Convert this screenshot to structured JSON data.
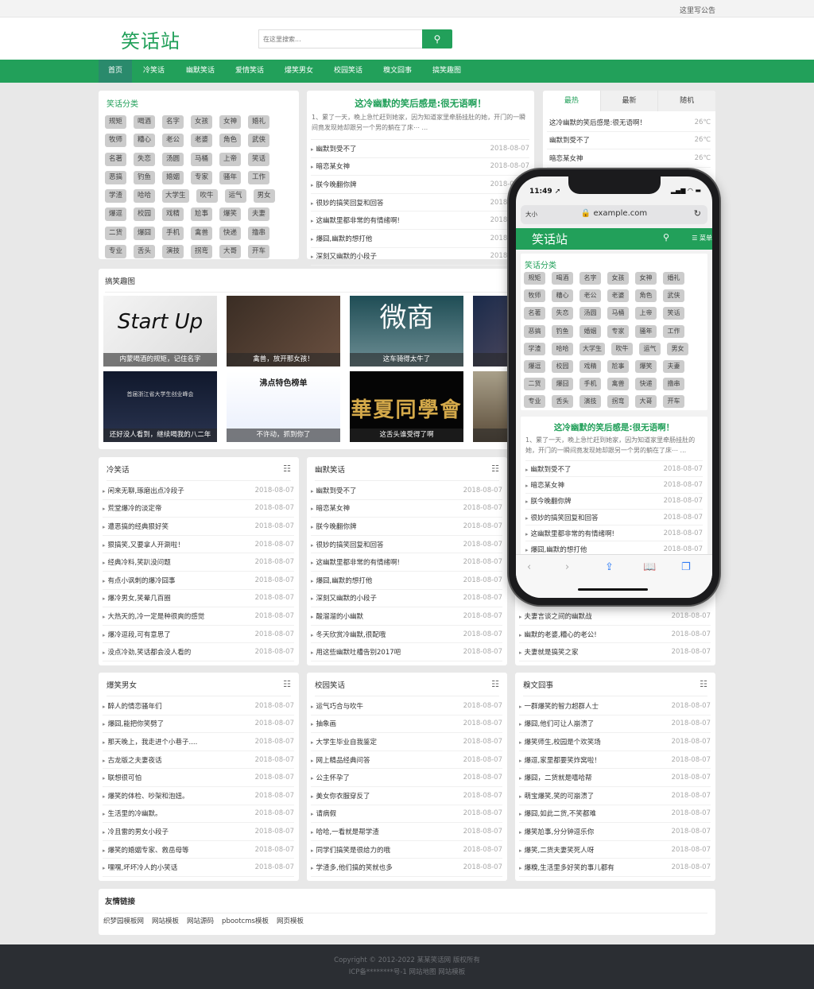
{
  "topbar": {
    "notice": "这里写公告"
  },
  "header": {
    "logo": "笑话站",
    "search_placeholder": "在这里搜索...",
    "search_icon": "search-icon"
  },
  "nav": [
    "首页",
    "冷笑话",
    "幽默笑话",
    "爱情笑话",
    "爆笑男女",
    "校园笑话",
    "糗文囧事",
    "搞笑趣图"
  ],
  "categories": {
    "title": "笑话分类",
    "rows": [
      [
        "规矩",
        "喝酒",
        "名字",
        "女孩",
        "女神",
        "婚礼"
      ],
      [
        "牧师",
        "糟心",
        "老公",
        "老婆",
        "角色",
        "武侠"
      ],
      [
        "名著",
        "失恋",
        "汤圆",
        "马桶",
        "上帝",
        "笑话"
      ],
      [
        "恶搞",
        "钓鱼",
        "婚姻",
        "专家",
        "骚年",
        "工作"
      ],
      [
        "学渣",
        "哈哈",
        "大学生",
        "吹牛",
        "运气",
        "男女"
      ],
      [
        "爆逗",
        "校园",
        "戏精",
        "尬事",
        "爆笑",
        "夫妻"
      ],
      [
        "二货",
        "爆囧",
        "手机",
        "禽兽",
        "快递",
        "撸串"
      ],
      [
        "专业",
        "舌头",
        "演技",
        "拐弯",
        "大哥",
        "开车"
      ]
    ]
  },
  "featured": {
    "title": "这冷幽默的笑后感是:很无语啊！",
    "summary": "1、累了一天，晚上急忙赶到她家，因为知道家里牵肠挂肚的她，开门的一瞬间竟发现她却跟另一个男的躺在了床⋯ ...",
    "items": [
      {
        "t": "幽默到受不了",
        "d": "2018-08-07"
      },
      {
        "t": "暗恋某女神",
        "d": "2018-08-07"
      },
      {
        "t": "朕今晚翻你牌",
        "d": "2018-08-07"
      },
      {
        "t": "很妙的搞笑回复和回答",
        "d": "2018-08-07"
      },
      {
        "t": "这幽默里都非常的有情绪啊!",
        "d": "2018-08-07"
      },
      {
        "t": "爆囧,幽默的想打他",
        "d": "2018-08-07"
      },
      {
        "t": "深刻又幽默的小段子",
        "d": "2018-08-07"
      }
    ]
  },
  "hot": {
    "tabs": [
      "最热",
      "最新",
      "随机"
    ],
    "items": [
      {
        "t": "这冷幽默的笑后感是:很无语啊！",
        "d": "26℃"
      },
      {
        "t": "幽默到受不了",
        "d": "26℃"
      },
      {
        "t": "暗恋某女神",
        "d": "26℃"
      }
    ]
  },
  "pictures": {
    "title": "搞笑趣图",
    "items": [
      {
        "caption": "内蒙喝酒的规矩，记住名字",
        "text": "Start Up"
      },
      {
        "caption": "禽兽，放开那女孩！"
      },
      {
        "caption": "这车骑得太牛了",
        "text": "微商"
      },
      {
        "caption": "拐弯的"
      },
      {
        "caption": "还好没人看到，继续喝我的八二年",
        "text": "首届浙江省大学生创业峰会"
      },
      {
        "caption": "不许动，抓到你了",
        "text": "沸点特色榜单"
      },
      {
        "caption": "这舌头谁受得了啊",
        "text": "華夏同學會"
      },
      {
        "caption": "迪拜人"
      }
    ]
  },
  "sections": [
    {
      "title": "冷笑话",
      "items": [
        {
          "t": "闲来无聊,琢磨出点冷段子",
          "d": "2018-08-07"
        },
        {
          "t": "荒堂爆冷的淡定帝",
          "d": "2018-08-07"
        },
        {
          "t": "遭恶搞的经典狠好笑",
          "d": "2018-08-07"
        },
        {
          "t": "狠搞笑,又要拿人开涮啦！",
          "d": "2018-08-07"
        },
        {
          "t": "经典冷料,笑趴没问题",
          "d": "2018-08-07"
        },
        {
          "t": "有点小讽刺的爆冷囧事",
          "d": "2018-08-07"
        },
        {
          "t": "爆冷男女,笑晕几百圈",
          "d": "2018-08-07"
        },
        {
          "t": "大热天的,冷一定是种很爽的感觉",
          "d": "2018-08-07"
        },
        {
          "t": "爆冷逗段,可有意思了",
          "d": "2018-08-07"
        },
        {
          "t": "没点冷劲,笑话都会没人看的",
          "d": "2018-08-07"
        }
      ]
    },
    {
      "title": "幽默笑话",
      "items": [
        {
          "t": "幽默到受不了",
          "d": "2018-08-07"
        },
        {
          "t": "暗恋某女神",
          "d": "2018-08-07"
        },
        {
          "t": "朕今晚翻你牌",
          "d": "2018-08-07"
        },
        {
          "t": "很妙的搞笑回复和回答",
          "d": "2018-08-07"
        },
        {
          "t": "这幽默里都非常的有情绪啊!",
          "d": "2018-08-07"
        },
        {
          "t": "爆囧,幽默的想打他",
          "d": "2018-08-07"
        },
        {
          "t": "深刻又幽默的小段子",
          "d": "2018-08-07"
        },
        {
          "t": "酸溜溜的小幽默",
          "d": "2018-08-07"
        },
        {
          "t": "冬天欣赏冷幽默,很配哦",
          "d": "2018-08-07"
        },
        {
          "t": "用这些幽默吐槽告别2017吧",
          "d": "2018-08-07"
        }
      ]
    },
    {
      "title": "",
      "items": [
        {
          "t": "夫妻言谈之间的幽默战",
          "d": "2018-08-07"
        },
        {
          "t": "幽默的老婆,糟心的老公!",
          "d": "2018-08-07"
        },
        {
          "t": "夫妻就是搞笑之家",
          "d": "2018-08-07"
        }
      ]
    },
    {
      "title": "爆笑男女",
      "items": [
        {
          "t": "醉人的情恋骚年们",
          "d": "2018-08-07"
        },
        {
          "t": "爆囧,能把你笑劈了",
          "d": "2018-08-07"
        },
        {
          "t": "那天晚上，我走进个小巷子....",
          "d": "2018-08-07"
        },
        {
          "t": "古龙版之夫妻夜话",
          "d": "2018-08-07"
        },
        {
          "t": "联想很可怕",
          "d": "2018-08-07"
        },
        {
          "t": "爆笑的体检、吵架和泡妞。",
          "d": "2018-08-07"
        },
        {
          "t": "生活里的冷幽默。",
          "d": "2018-08-07"
        },
        {
          "t": "冷且雷的男女小段子",
          "d": "2018-08-07"
        },
        {
          "t": "爆笑的婚姻专家、救岳母等",
          "d": "2018-08-07"
        },
        {
          "t": "嘿嘿,坏坏冷人的小笑话",
          "d": "2018-08-07"
        }
      ]
    },
    {
      "title": "校园笑话",
      "items": [
        {
          "t": "运气巧合与吹牛",
          "d": "2018-08-07"
        },
        {
          "t": "抽象画",
          "d": "2018-08-07"
        },
        {
          "t": "大学生毕业自我鉴定",
          "d": "2018-08-07"
        },
        {
          "t": "网上精品经典问答",
          "d": "2018-08-07"
        },
        {
          "t": "公主怀孕了",
          "d": "2018-08-07"
        },
        {
          "t": "美女你衣服穿反了",
          "d": "2018-08-07"
        },
        {
          "t": "请病假",
          "d": "2018-08-07"
        },
        {
          "t": "哈哈,一看就是帮学渣",
          "d": "2018-08-07"
        },
        {
          "t": "同学们搞笑是很给力的哦",
          "d": "2018-08-07"
        },
        {
          "t": "学渣多,他们搞的笑就也多",
          "d": "2018-08-07"
        }
      ]
    },
    {
      "title": "糗文囧事",
      "items": [
        {
          "t": "一群爆笑的智力超群人士",
          "d": "2018-08-07"
        },
        {
          "t": "爆囧,他们可让人崩溃了",
          "d": "2018-08-07"
        },
        {
          "t": "爆笑师生,校园是个欢笑场",
          "d": "2018-08-07"
        },
        {
          "t": "爆逗,家里都要笑炸窝啦！",
          "d": "2018-08-07"
        },
        {
          "t": "爆囧，二货就是嘻哈帮",
          "d": "2018-08-07"
        },
        {
          "t": "萌宝爆笑,笑的可崩溃了",
          "d": "2018-08-07"
        },
        {
          "t": "爆囧,如此二货,不笑都难",
          "d": "2018-08-07"
        },
        {
          "t": "爆笑尬事,分分钟逗乐你",
          "d": "2018-08-07"
        },
        {
          "t": "爆笑,二货夫妻笑死人呀",
          "d": "2018-08-07"
        },
        {
          "t": "爆糗,生活里多好笑的事儿都有",
          "d": "2018-08-07"
        }
      ]
    }
  ],
  "links": {
    "title": "友情链接",
    "items": [
      "织梦园模板网",
      "网站模板",
      "网站源码",
      "pbootcms模板",
      "网页模板"
    ]
  },
  "footer": {
    "line1": "Copyright © 2012-2022 某某笑话网 版权所有",
    "line2": "ICP备********号-1 网站地图 网站模板"
  },
  "phone": {
    "time": "11:49 ➚",
    "status": "▂▄▆ ◠ ▬",
    "text_size": "大小",
    "url": "🔒 example.com",
    "reload": "↻",
    "logo": "笑话站",
    "search": "⚲",
    "menu": "☰ 菜单",
    "featured_items": 6,
    "toolbar": [
      "‹",
      "›",
      "⇪",
      "📖",
      "❐"
    ]
  },
  "colors": {
    "brand": "#22a05a",
    "nav_active": "#2a8a6c",
    "footer": "#2b2e33"
  }
}
